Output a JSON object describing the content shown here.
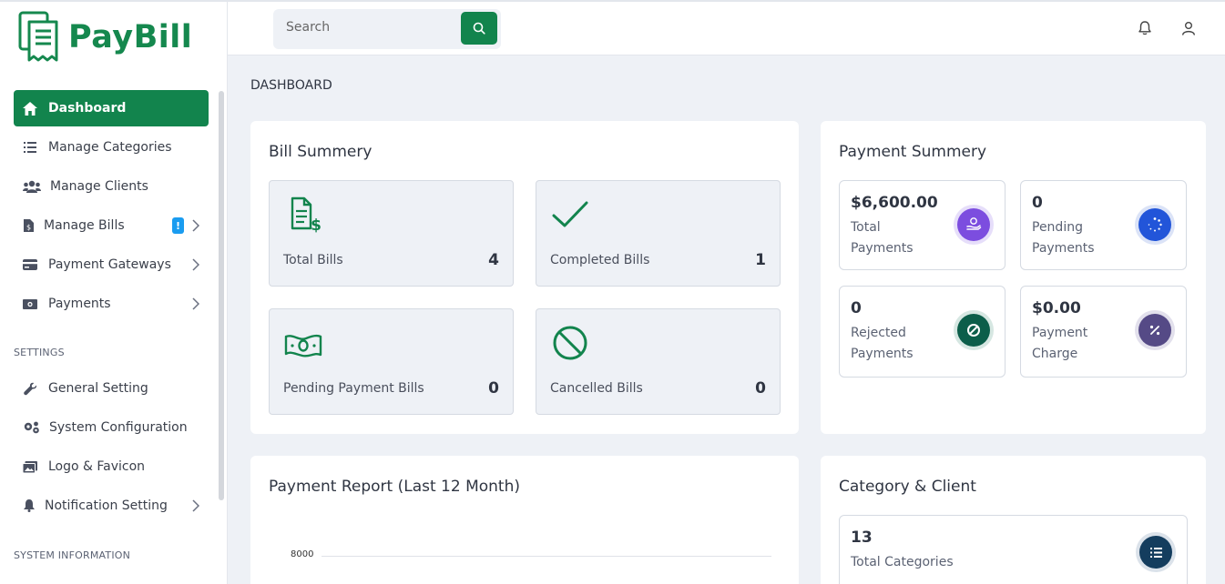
{
  "brand": {
    "name": "PayBill",
    "color": "#12844d"
  },
  "search": {
    "placeholder": "Search"
  },
  "sidebar": {
    "items": [
      {
        "label": "Dashboard",
        "icon": "home-icon",
        "active": true
      },
      {
        "label": "Manage Categories",
        "icon": "list-icon"
      },
      {
        "label": "Manage Clients",
        "icon": "users-icon"
      },
      {
        "label": "Manage Bills",
        "icon": "file-dollar-icon",
        "badge": "!"
      },
      {
        "label": "Payment Gateways",
        "icon": "credit-card-icon"
      },
      {
        "label": "Payments",
        "icon": "money-icon"
      }
    ],
    "settings_label": "SETTINGS",
    "settings_items": [
      {
        "label": "General Setting",
        "icon": "wrench-icon"
      },
      {
        "label": "System Configuration",
        "icon": "cogs-icon"
      },
      {
        "label": "Logo & Favicon",
        "icon": "image-icon"
      },
      {
        "label": "Notification Setting",
        "icon": "bell-icon"
      }
    ],
    "system_label": "SYSTEM INFORMATION"
  },
  "page": {
    "title": "DASHBOARD"
  },
  "bill_summary": {
    "title": "Bill Summery",
    "tiles": [
      {
        "label": "Total Bills",
        "value": "4",
        "icon": "invoice-dollar-icon"
      },
      {
        "label": "Completed Bills",
        "value": "1",
        "icon": "check-icon"
      },
      {
        "label": "Pending Payment Bills",
        "value": "0",
        "icon": "banknote-icon"
      },
      {
        "label": "Cancelled Bills",
        "value": "0",
        "icon": "ban-icon"
      }
    ]
  },
  "payment_summary": {
    "title": "Payment Summery",
    "tiles": [
      {
        "value": "$6,600.00",
        "label1": "Total",
        "label2": "Payments",
        "icon": "hand-coin-icon",
        "color": "#7c4ddf"
      },
      {
        "value": "0",
        "label1": "Pending",
        "label2": "Payments",
        "icon": "spinner-icon",
        "color": "#2255d9"
      },
      {
        "value": "0",
        "label1": "Rejected",
        "label2": "Payments",
        "icon": "ban-icon",
        "color": "#0c5e4a"
      },
      {
        "value": "$0.00",
        "label1": "Payment",
        "label2": "Charge",
        "icon": "percent-icon",
        "color": "#554a86"
      }
    ]
  },
  "payment_report": {
    "title": "Payment Report (Last 12 Month)",
    "y_tick_top": "8000"
  },
  "category_client": {
    "title": "Category & Client",
    "tiles": [
      {
        "value": "13",
        "label": "Total Categories",
        "icon": "list-icon",
        "color": "#143d5e"
      }
    ]
  }
}
